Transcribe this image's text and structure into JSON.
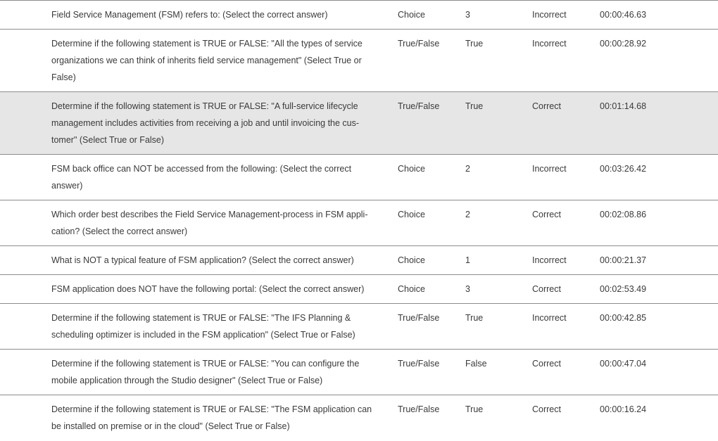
{
  "results": {
    "rows": [
      {
        "question": "Field Service Management (FSM) refers to: (Select the correct answer)",
        "type": "Choice",
        "answer": "3",
        "result": "Incorrect",
        "time": "00:00:46.63"
      },
      {
        "question": "Determine if the following statement is TRUE or FALSE: \"All the types of service organizations we can think of inherits field service management\" (Select True or False)",
        "type": "True/False",
        "answer": "True",
        "result": "Incorrect",
        "time": "00:00:28.92"
      },
      {
        "question": "Determine if the following statement is TRUE or FALSE: \"A full-service lifecycle management includes activities from receiving a job and until invoicing the cus-tomer\" (Select True or False)",
        "type": "True/False",
        "answer": "True",
        "result": "Correct",
        "time": "00:01:14.68"
      },
      {
        "question": "FSM back office can NOT be accessed from the following: (Select the correct answer)",
        "type": "Choice",
        "answer": "2",
        "result": "Incorrect",
        "time": "00:03:26.42"
      },
      {
        "question": "Which order best describes the Field Service Management-process in FSM appli-cation? (Select the correct answer)",
        "type": "Choice",
        "answer": "2",
        "result": "Correct",
        "time": "00:02:08.86"
      },
      {
        "question": "What is NOT a typical feature of FSM application? (Select the correct answer)",
        "type": "Choice",
        "answer": "1",
        "result": "Incorrect",
        "time": "00:00:21.37"
      },
      {
        "question": "FSM application does NOT have the following portal: (Select the correct answer)",
        "type": "Choice",
        "answer": "3",
        "result": "Correct",
        "time": "00:02:53.49"
      },
      {
        "question": "Determine if the following statement is TRUE or FALSE: \"The IFS Planning & scheduling optimizer is included in the FSM application\" (Select True or False)",
        "type": "True/False",
        "answer": "True",
        "result": "Incorrect",
        "time": "00:00:42.85"
      },
      {
        "question": "Determine if the following statement is TRUE or FALSE: \"You can configure the mobile application through the Studio designer\" (Select True or False)",
        "type": "True/False",
        "answer": "False",
        "result": "Correct",
        "time": "00:00:47.04"
      },
      {
        "question": "Determine if the following statement is TRUE or FALSE: \"The FSM application can be installed on premise or in the cloud\" (Select True or False)",
        "type": "True/False",
        "answer": "True",
        "result": "Correct",
        "time": "00:00:16.24"
      }
    ]
  },
  "colors": {
    "highlight_row": "#e6e6e6",
    "divider": "#8c8c8c",
    "text": "#3a3a3a"
  }
}
